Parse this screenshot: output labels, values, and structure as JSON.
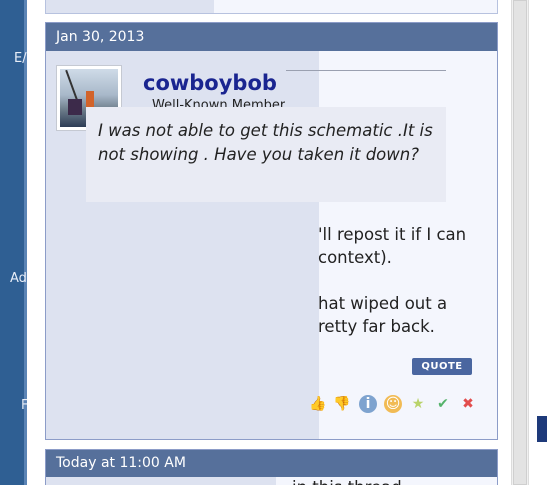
{
  "left_strip": {
    "fragments": [
      "E/",
      "Ad",
      "F"
    ]
  },
  "post": {
    "date": "Jan 30, 2013",
    "username": "cowboybob",
    "user_title": "Well-Known Member",
    "quote_text": "I was not able to get this schematic .It is not showing . Have you taken it down?",
    "body_lines": [
      "'ll repost it if I can",
      "context).",
      "hat wiped out a",
      "retty far back."
    ],
    "quote_button": "QUOTE",
    "rating_icons": [
      "like-icon",
      "dislike-icon",
      "info-icon",
      "smile-icon",
      "star-icon",
      "check-icon",
      "x-icon"
    ]
  },
  "next_post": {
    "date": "Today at 11:00 AM",
    "fragment": "in this thread"
  }
}
